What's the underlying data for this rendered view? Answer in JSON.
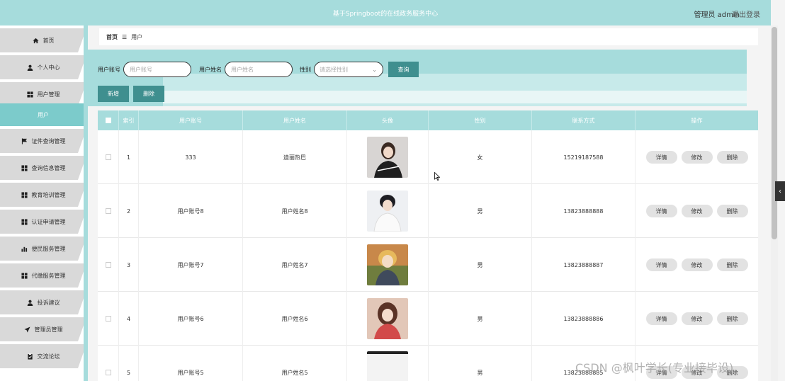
{
  "header": {
    "title": "基于Springboot的在线政务服务中心",
    "user": "管理员 admin",
    "logout": "退出登录"
  },
  "sidebar": {
    "items": [
      {
        "label": "首页",
        "icon": "home-icon"
      },
      {
        "label": "个人中心",
        "icon": "user-icon"
      },
      {
        "label": "用户管理",
        "icon": "grid-icon"
      },
      {
        "label": "用户",
        "icon": "",
        "active": true
      },
      {
        "label": "证件查询管理",
        "icon": "flag-icon"
      },
      {
        "label": "查询信息管理",
        "icon": "grid-icon"
      },
      {
        "label": "教育培训管理",
        "icon": "grid-icon"
      },
      {
        "label": "认证申请管理",
        "icon": "grid-icon"
      },
      {
        "label": "便民服务管理",
        "icon": "bar-chart-icon"
      },
      {
        "label": "代缴服务管理",
        "icon": "grid-icon"
      },
      {
        "label": "投诉建议",
        "icon": "user-icon"
      },
      {
        "label": "管理员管理",
        "icon": "send-icon"
      },
      {
        "label": "交流论坛",
        "icon": "clipboard-icon"
      }
    ]
  },
  "breadcrumb": {
    "home": "首页",
    "sep": "☰",
    "current": "用户"
  },
  "search": {
    "account_label": "用户账号",
    "account_placeholder": "用户账号",
    "name_label": "用户姓名",
    "name_placeholder": "用户姓名",
    "gender_label": "性别",
    "gender_placeholder": "请选择性别",
    "query_button": "查询"
  },
  "actions": {
    "add": "新增",
    "delete": "删除"
  },
  "table": {
    "headers": [
      "索引",
      "用户账号",
      "用户姓名",
      "头像",
      "性别",
      "联系方式",
      "操作"
    ],
    "row_buttons": {
      "detail": "详情",
      "edit": "修改",
      "delete": "删除"
    },
    "rows": [
      {
        "index": "1",
        "account": "333",
        "name": "迪丽热巴",
        "gender": "女",
        "phone": "15219187588"
      },
      {
        "index": "2",
        "account": "用户账号8",
        "name": "用户姓名8",
        "gender": "男",
        "phone": "13823888888"
      },
      {
        "index": "3",
        "account": "用户账号7",
        "name": "用户姓名7",
        "gender": "男",
        "phone": "13823888887"
      },
      {
        "index": "4",
        "account": "用户账号6",
        "name": "用户姓名6",
        "gender": "男",
        "phone": "13823888886"
      },
      {
        "index": "5",
        "account": "用户账号5",
        "name": "用户姓名5",
        "gender": "男",
        "phone": "13823888885"
      }
    ]
  },
  "watermark": "CSDN @枫叶学长(专业接毕设)",
  "colors": {
    "accent": "#a6dcdc",
    "button": "#3f8f8f"
  }
}
